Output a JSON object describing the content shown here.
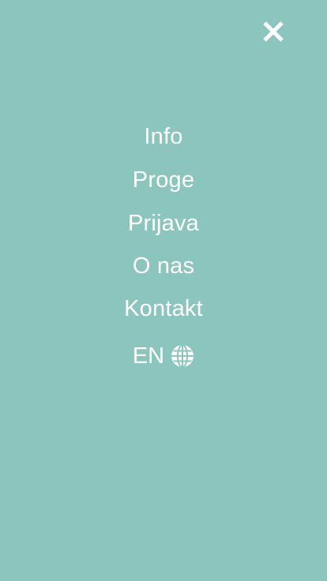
{
  "header": {
    "close_icon": "close-icon"
  },
  "menu": {
    "items": [
      {
        "label": "Info"
      },
      {
        "label": "Proge"
      },
      {
        "label": "Prijava"
      },
      {
        "label": "O nas"
      },
      {
        "label": "Kontakt"
      }
    ]
  },
  "language": {
    "label": "EN",
    "icon": "globe-icon"
  },
  "colors": {
    "background": "#8cc5bd",
    "text": "#ffffff"
  }
}
